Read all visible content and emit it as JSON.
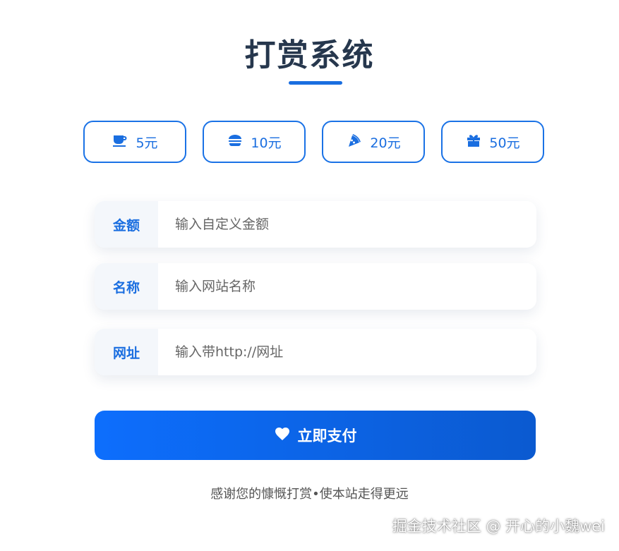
{
  "title": "打赏系统",
  "amount_options": [
    {
      "label": "5元",
      "icon": "coffee-icon"
    },
    {
      "label": "10元",
      "icon": "burger-icon"
    },
    {
      "label": "20元",
      "icon": "pizza-icon"
    },
    {
      "label": "50元",
      "icon": "gift-icon"
    }
  ],
  "form": {
    "amount": {
      "label": "金额",
      "placeholder": "输入自定义金额",
      "value": ""
    },
    "name": {
      "label": "名称",
      "placeholder": "输入网站名称",
      "value": ""
    },
    "url": {
      "label": "网址",
      "placeholder": "输入带http://网址",
      "value": ""
    }
  },
  "pay_button": {
    "label": "立即支付",
    "icon": "heart-icon"
  },
  "thanks_text": "感谢您的慷慨打赏•使本站走得更远",
  "watermark": "掘金技术社区 @ 开心的小魏wei",
  "colors": {
    "accent": "#1a6ee0",
    "title": "#26374d",
    "button_gradient_start": "#0d6efd",
    "button_gradient_end": "#0b5ad0"
  }
}
